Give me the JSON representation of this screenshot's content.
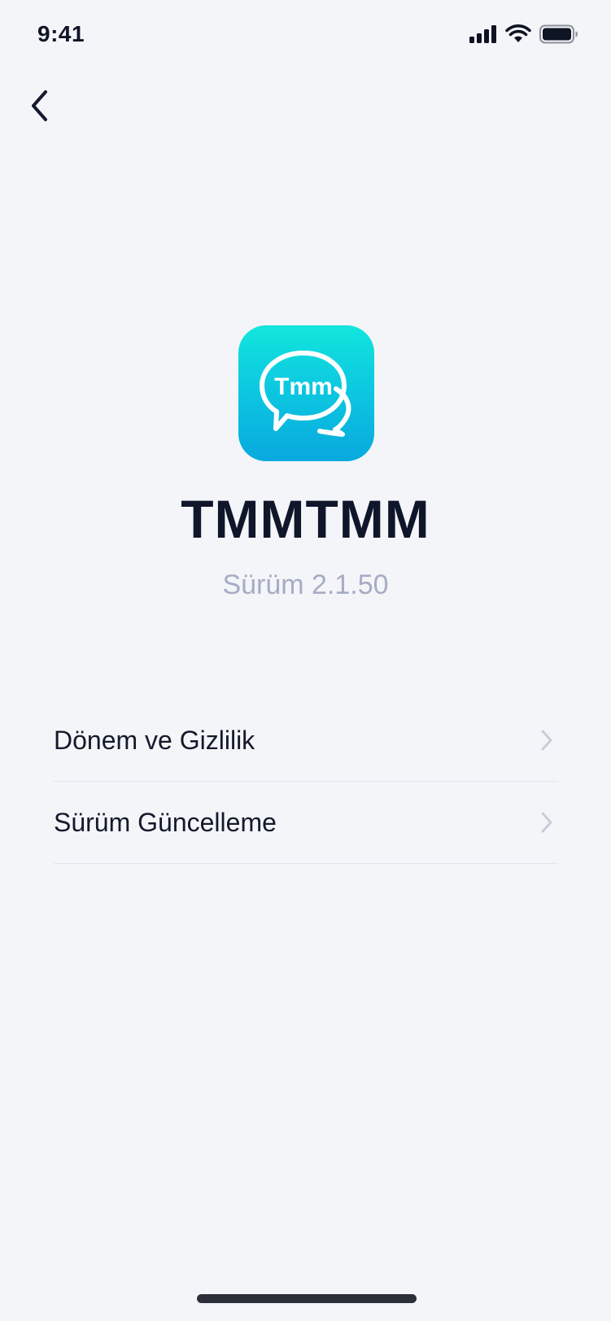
{
  "status_bar": {
    "time": "9:41",
    "icons": [
      "cellular-signal-icon",
      "wifi-icon",
      "battery-icon"
    ]
  },
  "nav": {
    "back_icon": "chevron-left-icon"
  },
  "app": {
    "icon_text": "Tmm",
    "icon_gradient": [
      "#12e6dc",
      "#08a9de"
    ],
    "name": "TMMTMM",
    "version": "Sürüm 2.1.50"
  },
  "menu": {
    "items": [
      {
        "label": "Dönem ve Gizlilik",
        "icon": "chevron-right-icon"
      },
      {
        "label": "Sürüm Güncelleme",
        "icon": "chevron-right-icon"
      }
    ]
  },
  "colors": {
    "background": "#f3f5f9",
    "primary_text": "#141a2b",
    "secondary_text": "#a6acc4",
    "divider": "#e2e5ec",
    "chevron": "#c9cdd8"
  }
}
